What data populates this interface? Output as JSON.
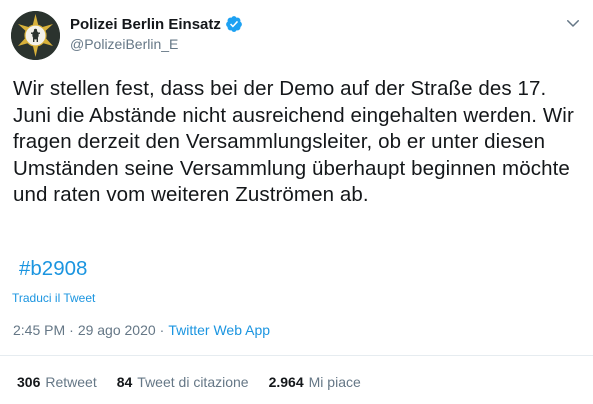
{
  "author": {
    "name": "Polizei Berlin Einsatz",
    "handle": "@PolizeiBerlin_E",
    "verified": true,
    "avatar_icon": "police-star-badge-icon"
  },
  "tweet": {
    "text": "Wir stellen fest, dass bei der Demo auf der Straße des 17. Juni die Abstände nicht ausreichend eingehalten werden. Wir fragen derzeit den Versammlungsleiter, ob er unter diesen Umständen seine Versammlung überhaupt beginnen möchte und raten vom weiteren Zuströmen ab.",
    "hashtag": "#b2908",
    "translate_label": "Traduci il Tweet"
  },
  "meta": {
    "time": "2:45 PM",
    "separator": "·",
    "date": "29 ago 2020",
    "separator2": "·",
    "source": "Twitter Web App"
  },
  "stats": {
    "retweets": {
      "count": "306",
      "label": "Retweet"
    },
    "quotes": {
      "count": "84",
      "label": "Tweet di citazione"
    },
    "likes": {
      "count": "2.964",
      "label": "Mi piace"
    }
  },
  "colors": {
    "link": "#1b95e0",
    "text": "#14171a",
    "muted": "#657786",
    "divider": "#e6ecf0",
    "verified": "#1da1f2"
  }
}
